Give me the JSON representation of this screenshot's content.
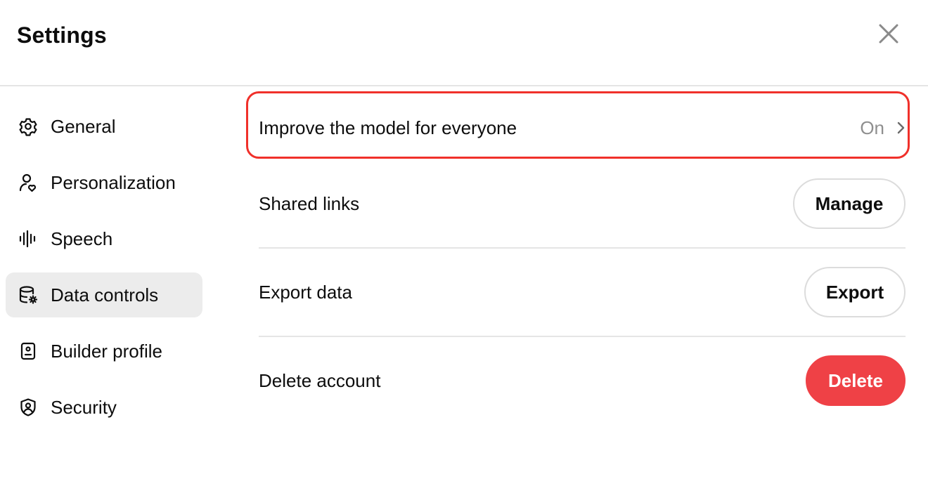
{
  "dialog": {
    "title": "Settings",
    "close_icon": "close-icon"
  },
  "sidebar": {
    "items": [
      {
        "label": "General",
        "icon": "gear-icon",
        "active": false
      },
      {
        "label": "Personalization",
        "icon": "person-heart-icon",
        "active": false
      },
      {
        "label": "Speech",
        "icon": "waveform-icon",
        "active": false
      },
      {
        "label": "Data controls",
        "icon": "database-gear-icon",
        "active": true
      },
      {
        "label": "Builder profile",
        "icon": "id-badge-icon",
        "active": false
      },
      {
        "label": "Security",
        "icon": "shield-user-icon",
        "active": false
      }
    ]
  },
  "data_controls": {
    "improve_model": {
      "label": "Improve the model for everyone",
      "value": "On",
      "icon": "chevron-right-icon",
      "highlight_color": "#f0302a"
    },
    "shared_links": {
      "label": "Shared links",
      "button": "Manage"
    },
    "export_data": {
      "label": "Export data",
      "button": "Export"
    },
    "delete_account": {
      "label": "Delete account",
      "button": "Delete",
      "button_color": "#ef4146"
    }
  }
}
